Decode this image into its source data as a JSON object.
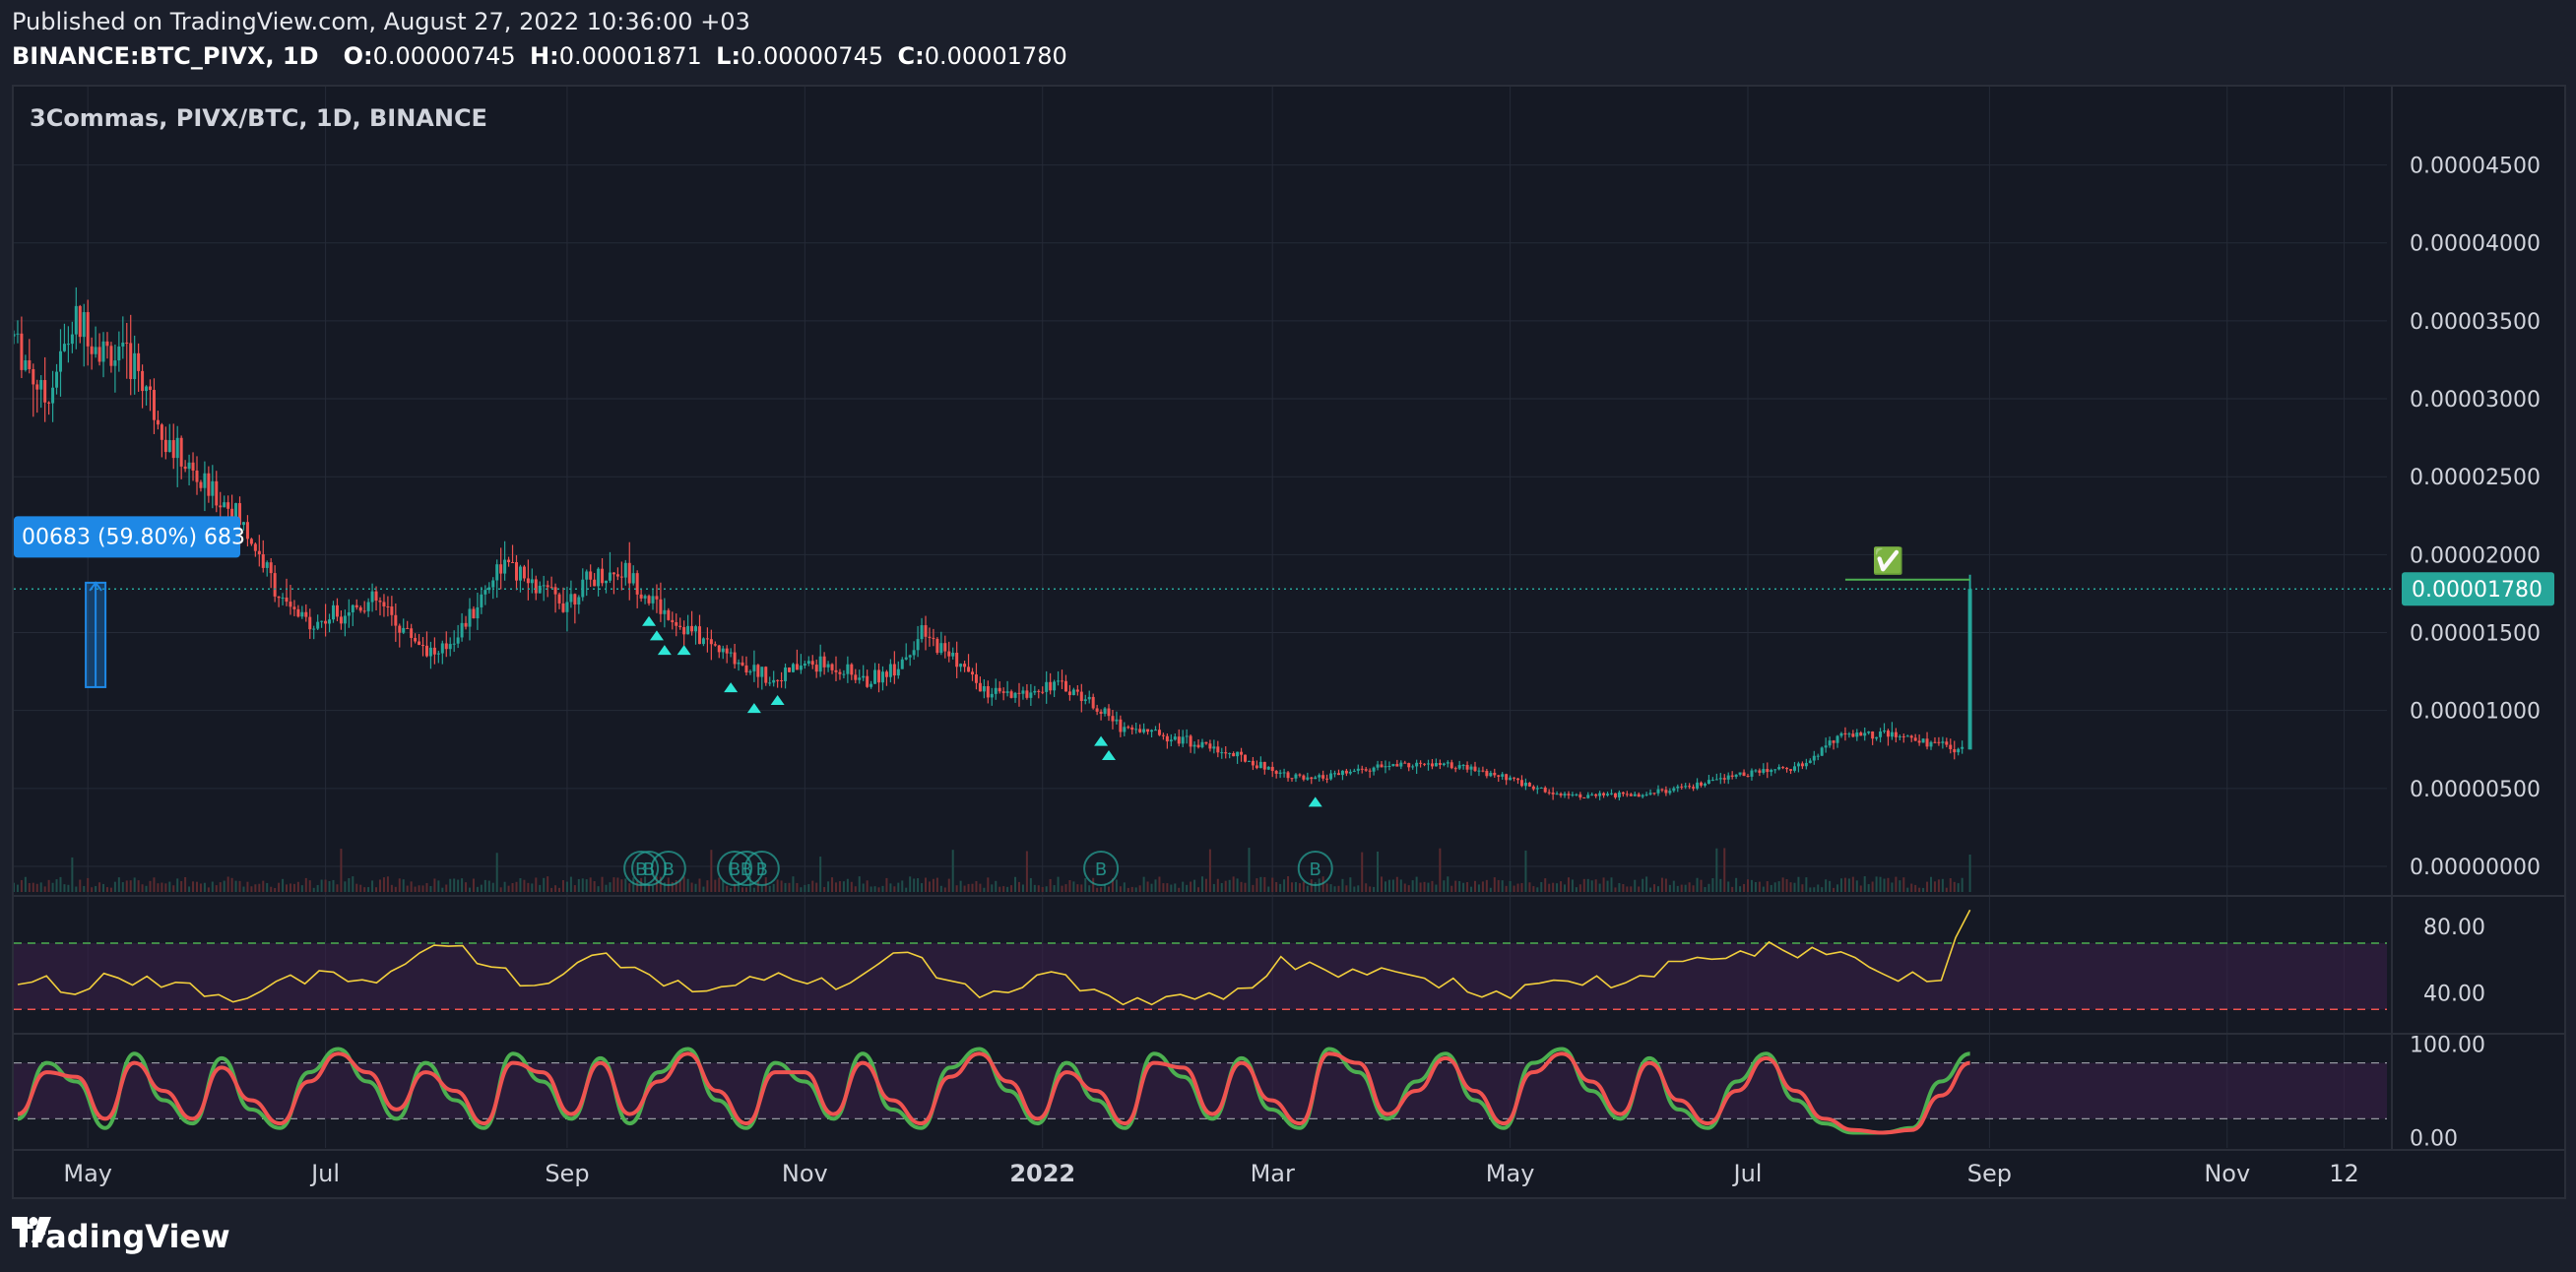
{
  "header": {
    "published": "Published on TradingView.com, August 27, 2022 10:36:00 +03",
    "symbol": "BINANCE:BTC_PIVX, 1D",
    "o_label": "O:",
    "o_value": "0.00000745",
    "h_label": "H:",
    "h_value": "0.00001871",
    "l_label": "L:",
    "l_value": "0.00000745",
    "c_label": "C:",
    "c_value": "0.00001780"
  },
  "chart_title": "3Commas, PIVX/BTC, 1D, BINANCE",
  "measure_label": "00683 (59.80%) 683",
  "last_price_label": "0.00001780",
  "checkmark": "✅",
  "buy_marker_glyph": "B",
  "footer": {
    "brand": "TradingView"
  },
  "colors": {
    "background": "#151924",
    "up": "#26a69a",
    "down": "#ef5350",
    "grid": "#252a37",
    "rsi_line": "#f2cf3c",
    "stoch_k": "#4caf50",
    "stoch_d": "#ef5350",
    "band": "#3b1f48",
    "last_price": "#26a69a",
    "measure": "#1e88e5"
  },
  "chart_data": [
    {
      "type": "candlestick",
      "title": "3Commas, PIVX/BTC, 1D, BINANCE",
      "y_ticks": [
        "0.00004500",
        "0.00004000",
        "0.00003500",
        "0.00003000",
        "0.00002500",
        "0.00002000",
        "0.00001500",
        "0.00001000",
        "0.00000500",
        "0.00000000"
      ],
      "ylim": [
        0,
        4.75e-05
      ],
      "x_ticks": [
        "May",
        "Jul",
        "Sep",
        "Nov",
        "2022",
        "Mar",
        "May",
        "Jul",
        "Sep",
        "Nov",
        "12"
      ],
      "x_start": "2021-04-12",
      "x_end": "2022-12-12",
      "close_path": [
        [
          "2021-04-12",
          3.4e-05
        ],
        [
          "2021-04-20",
          3e-05
        ],
        [
          "2021-04-28",
          3.5e-05
        ],
        [
          "2021-05-06",
          3.3e-05
        ],
        [
          "2021-05-14",
          3.2e-05
        ],
        [
          "2021-05-22",
          2.7e-05
        ],
        [
          "2021-05-30",
          2.45e-05
        ],
        [
          "2021-06-07",
          2.3e-05
        ],
        [
          "2021-06-14",
          2e-05
        ],
        [
          "2021-06-21",
          1.65e-05
        ],
        [
          "2021-06-28",
          1.55e-05
        ],
        [
          "2021-07-06",
          1.65e-05
        ],
        [
          "2021-07-14",
          1.7e-05
        ],
        [
          "2021-07-22",
          1.5e-05
        ],
        [
          "2021-07-30",
          1.35e-05
        ],
        [
          "2021-08-07",
          1.6e-05
        ],
        [
          "2021-08-15",
          1.95e-05
        ],
        [
          "2021-08-23",
          1.8e-05
        ],
        [
          "2021-08-31",
          1.7e-05
        ],
        [
          "2021-09-08",
          1.85e-05
        ],
        [
          "2021-09-16",
          1.9e-05
        ],
        [
          "2021-09-22",
          1.72e-05
        ],
        [
          "2021-09-30",
          1.55e-05
        ],
        [
          "2021-10-08",
          1.42e-05
        ],
        [
          "2021-10-16",
          1.3e-05
        ],
        [
          "2021-10-24",
          1.2e-05
        ],
        [
          "2021-11-01",
          1.3e-05
        ],
        [
          "2021-11-09",
          1.28e-05
        ],
        [
          "2021-11-17",
          1.18e-05
        ],
        [
          "2021-11-25",
          1.3e-05
        ],
        [
          "2021-12-01",
          1.48e-05
        ],
        [
          "2021-12-09",
          1.35e-05
        ],
        [
          "2021-12-17",
          1.12e-05
        ],
        [
          "2021-12-25",
          1.08e-05
        ],
        [
          "2022-01-03",
          1.18e-05
        ],
        [
          "2022-01-11",
          1.1e-05
        ],
        [
          "2022-01-21",
          9e-06
        ],
        [
          "2022-02-01",
          8.5e-06
        ],
        [
          "2022-02-15",
          7.5e-06
        ],
        [
          "2022-03-01",
          6.2e-06
        ],
        [
          "2022-03-10",
          5.5e-06
        ],
        [
          "2022-03-20",
          6e-06
        ],
        [
          "2022-04-01",
          6.5e-06
        ],
        [
          "2022-04-15",
          6.5e-06
        ],
        [
          "2022-05-01",
          5.6e-06
        ],
        [
          "2022-05-10",
          4.8e-06
        ],
        [
          "2022-05-20",
          4.5e-06
        ],
        [
          "2022-06-01",
          4.6e-06
        ],
        [
          "2022-06-15",
          5e-06
        ],
        [
          "2022-07-01",
          6e-06
        ],
        [
          "2022-07-15",
          6.5e-06
        ],
        [
          "2022-07-25",
          8.5e-06
        ],
        [
          "2022-08-05",
          8.5e-06
        ],
        [
          "2022-08-15",
          8e-06
        ],
        [
          "2022-08-25",
          7.5e-06
        ],
        [
          "2022-08-27",
          1.78e-05
        ]
      ],
      "last_close": 1.78e-05,
      "last_high": 1.871e-05,
      "buy_signal_dates": [
        "2021-09-22",
        "2021-09-24",
        "2021-09-26",
        "2021-10-01",
        "2021-10-13",
        "2021-10-19",
        "2021-10-25",
        "2022-01-16",
        "2022-01-18",
        "2022-03-12"
      ],
      "deal_marker_dates": [
        "2021-09-20",
        "2021-09-22",
        "2021-09-27",
        "2021-10-14",
        "2021-10-17",
        "2021-10-21",
        "2022-01-16",
        "2022-03-12"
      ]
    },
    {
      "type": "line",
      "name": "RSI",
      "y_ticks": [
        "80.00",
        "40.00"
      ],
      "bands": [
        70,
        30
      ],
      "ylim": [
        20,
        95
      ],
      "values": [
        45,
        48,
        42,
        50,
        44,
        46,
        43,
        40,
        38,
        44,
        48,
        52,
        46,
        56,
        62,
        68,
        60,
        52,
        46,
        52,
        60,
        58,
        50,
        46,
        44,
        42,
        48,
        50,
        46,
        48,
        58,
        62,
        52,
        44,
        40,
        46,
        50,
        42,
        40,
        34,
        40,
        36,
        34,
        46,
        60,
        58,
        52,
        48,
        54,
        50,
        46,
        40,
        36,
        44,
        50,
        48,
        46,
        52,
        56,
        62,
        66,
        68,
        64,
        62,
        60,
        54,
        50,
        48,
        92
      ]
    },
    {
      "type": "line",
      "name": "Stoch RSI",
      "y_ticks": [
        "100.00",
        "0.00"
      ],
      "bands": [
        80,
        20
      ],
      "ylim": [
        -5,
        105
      ],
      "k": [
        20,
        80,
        60,
        10,
        90,
        40,
        15,
        85,
        30,
        10,
        70,
        95,
        60,
        20,
        80,
        40,
        10,
        90,
        60,
        20,
        85,
        15,
        70,
        95,
        40,
        10,
        80,
        60,
        20,
        90,
        30,
        10,
        75,
        95,
        50,
        15,
        80,
        40,
        10,
        90,
        65,
        20,
        85,
        30,
        10,
        95,
        70,
        20,
        60,
        90,
        40,
        10,
        80,
        95,
        50,
        20,
        85,
        30,
        10,
        60,
        90,
        40,
        15,
        5,
        5,
        10,
        60,
        90
      ],
      "d": [
        25,
        70,
        65,
        20,
        80,
        50,
        20,
        75,
        40,
        15,
        60,
        90,
        70,
        30,
        70,
        50,
        15,
        80,
        70,
        25,
        80,
        25,
        60,
        90,
        50,
        15,
        70,
        70,
        25,
        80,
        40,
        15,
        65,
        90,
        60,
        20,
        70,
        50,
        15,
        80,
        75,
        25,
        80,
        40,
        15,
        90,
        80,
        25,
        50,
        85,
        50,
        15,
        70,
        90,
        60,
        25,
        80,
        40,
        15,
        50,
        85,
        50,
        20,
        8,
        5,
        8,
        45,
        80
      ]
    }
  ]
}
